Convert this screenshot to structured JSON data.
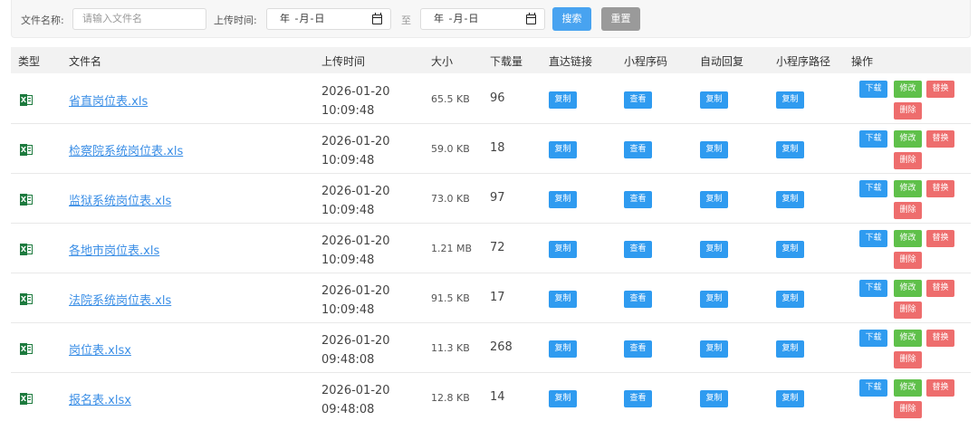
{
  "search": {
    "filename_label": "文件名称:",
    "filename_placeholder": "请输入文件名",
    "upload_time_label": "上传时间:",
    "date_from": "年 -月-日",
    "range_sep": "至",
    "date_to": "年 -月-日",
    "search_button": "搜索",
    "reset_button": "重置"
  },
  "table": {
    "columns": [
      "类型",
      "文件名",
      "上传时间",
      "大小",
      "下载量",
      "直达链接",
      "小程序码",
      "自动回复",
      "小程序路径",
      "操作"
    ],
    "rows": [
      {
        "icon": "excel-icon",
        "name": "省直岗位表.xls",
        "date": "2026-01-20",
        "time": "10:09:48",
        "size": "65.5 KB",
        "downloads": "96"
      },
      {
        "icon": "excel-icon",
        "name": "检察院系统岗位表.xls",
        "date": "2026-01-20",
        "time": "10:09:48",
        "size": "59.0 KB",
        "downloads": "18"
      },
      {
        "icon": "excel-icon",
        "name": "监狱系统岗位表.xls",
        "date": "2026-01-20",
        "time": "10:09:48",
        "size": "73.0 KB",
        "downloads": "97"
      },
      {
        "icon": "excel-icon",
        "name": "各地市岗位表.xls",
        "date": "2026-01-20",
        "time": "10:09:48",
        "size": "1.21 MB",
        "downloads": "72"
      },
      {
        "icon": "excel-icon",
        "name": "法院系统岗位表.xls",
        "date": "2026-01-20",
        "time": "10:09:48",
        "size": "91.5 KB",
        "downloads": "17"
      },
      {
        "icon": "excel-icon",
        "name": "岗位表.xlsx",
        "date": "2026-01-20",
        "time": "09:48:08",
        "size": "11.3 KB",
        "downloads": "268"
      },
      {
        "icon": "excel-icon",
        "name": "报名表.xlsx",
        "date": "2026-01-20",
        "time": "09:48:08",
        "size": "12.8 KB",
        "downloads": "14"
      }
    ],
    "buttons": {
      "copy": "复制",
      "view": "查看",
      "download": "下载",
      "edit": "修改",
      "replace": "替换",
      "delete": "删除"
    }
  },
  "colors": {
    "primary": "#48a3f0",
    "tag_blue": "#2f9bf0",
    "tag_green": "#5fc04a",
    "tag_red": "#ee6d6d",
    "link": "#3a8ee6",
    "excel_green": "#1d7a3e"
  }
}
